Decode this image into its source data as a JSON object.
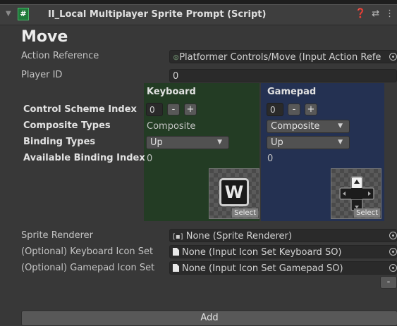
{
  "header": {
    "fold": "▼",
    "script_icon": "#",
    "title": "II_Local Multiplayer Sprite Prompt (Script)",
    "icons": [
      "help-icon",
      "presets-icon",
      "menu-icon"
    ],
    "icon_glyphs": [
      "❓",
      "⇄",
      "⋮"
    ]
  },
  "section_title": "Move",
  "action_reference": {
    "label": "Action Reference",
    "value": "Platformer Controls/Move (Input Action Refe"
  },
  "player_id": {
    "label": "Player ID",
    "value": "0"
  },
  "rows": {
    "control_scheme_index": "Control Scheme Index",
    "composite_types": "Composite Types",
    "binding_types": "Binding Types",
    "available_binding_index": "Available Binding Index"
  },
  "keyboard": {
    "header": "Keyboard",
    "index": "0",
    "minus": "-",
    "plus": "+",
    "composite_text": "Composite",
    "binding_type": "Up",
    "available_index": "0",
    "key_letter": "W",
    "select": "Select",
    "color": "#233c24"
  },
  "gamepad": {
    "header": "Gamepad",
    "index": "0",
    "minus": "-",
    "plus": "+",
    "composite_type": "Composite",
    "binding_type": "Up",
    "available_index": "0",
    "select": "Select",
    "color": "#243152"
  },
  "sprite_renderer": {
    "label": "Sprite Renderer",
    "value": "None (Sprite Renderer)"
  },
  "keyboard_icon_set": {
    "label": "(Optional) Keyboard Icon Set",
    "value": "None (Input Icon Set Keyboard SO)"
  },
  "gamepad_icon_set": {
    "label": "(Optional) Gamepad Icon Set",
    "value": "None (Input Icon Set Gamepad SO)"
  },
  "remove_label": "-",
  "add_label": "Add"
}
